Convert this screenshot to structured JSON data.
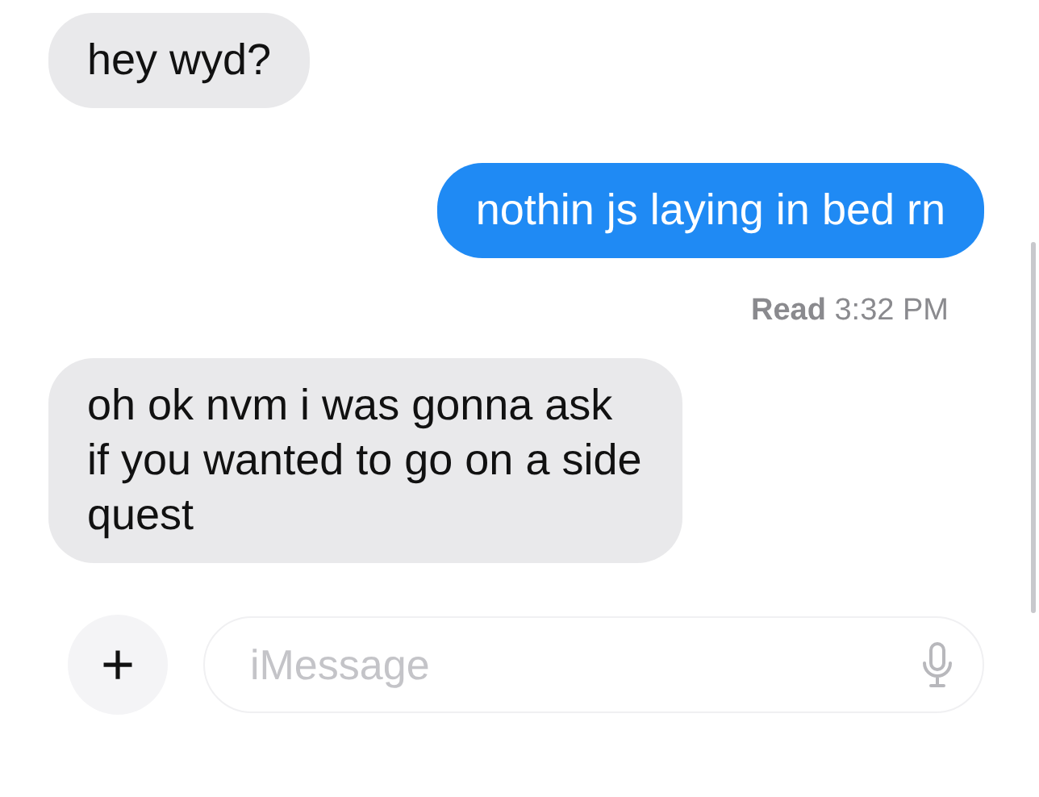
{
  "messages": [
    {
      "kind": "incoming",
      "text": "hey wyd?"
    },
    {
      "kind": "outgoing",
      "text": "nothin js laying in bed rn"
    },
    {
      "kind": "receipt",
      "text": "**Read** 3:32 PM"
    },
    {
      "kind": "incoming",
      "text": "oh ok nvm i was gonna ask if you wanted to go on a side quest"
    }
  ],
  "composer": {
    "add_button": "+",
    "placeholder": "iMessage"
  }
}
